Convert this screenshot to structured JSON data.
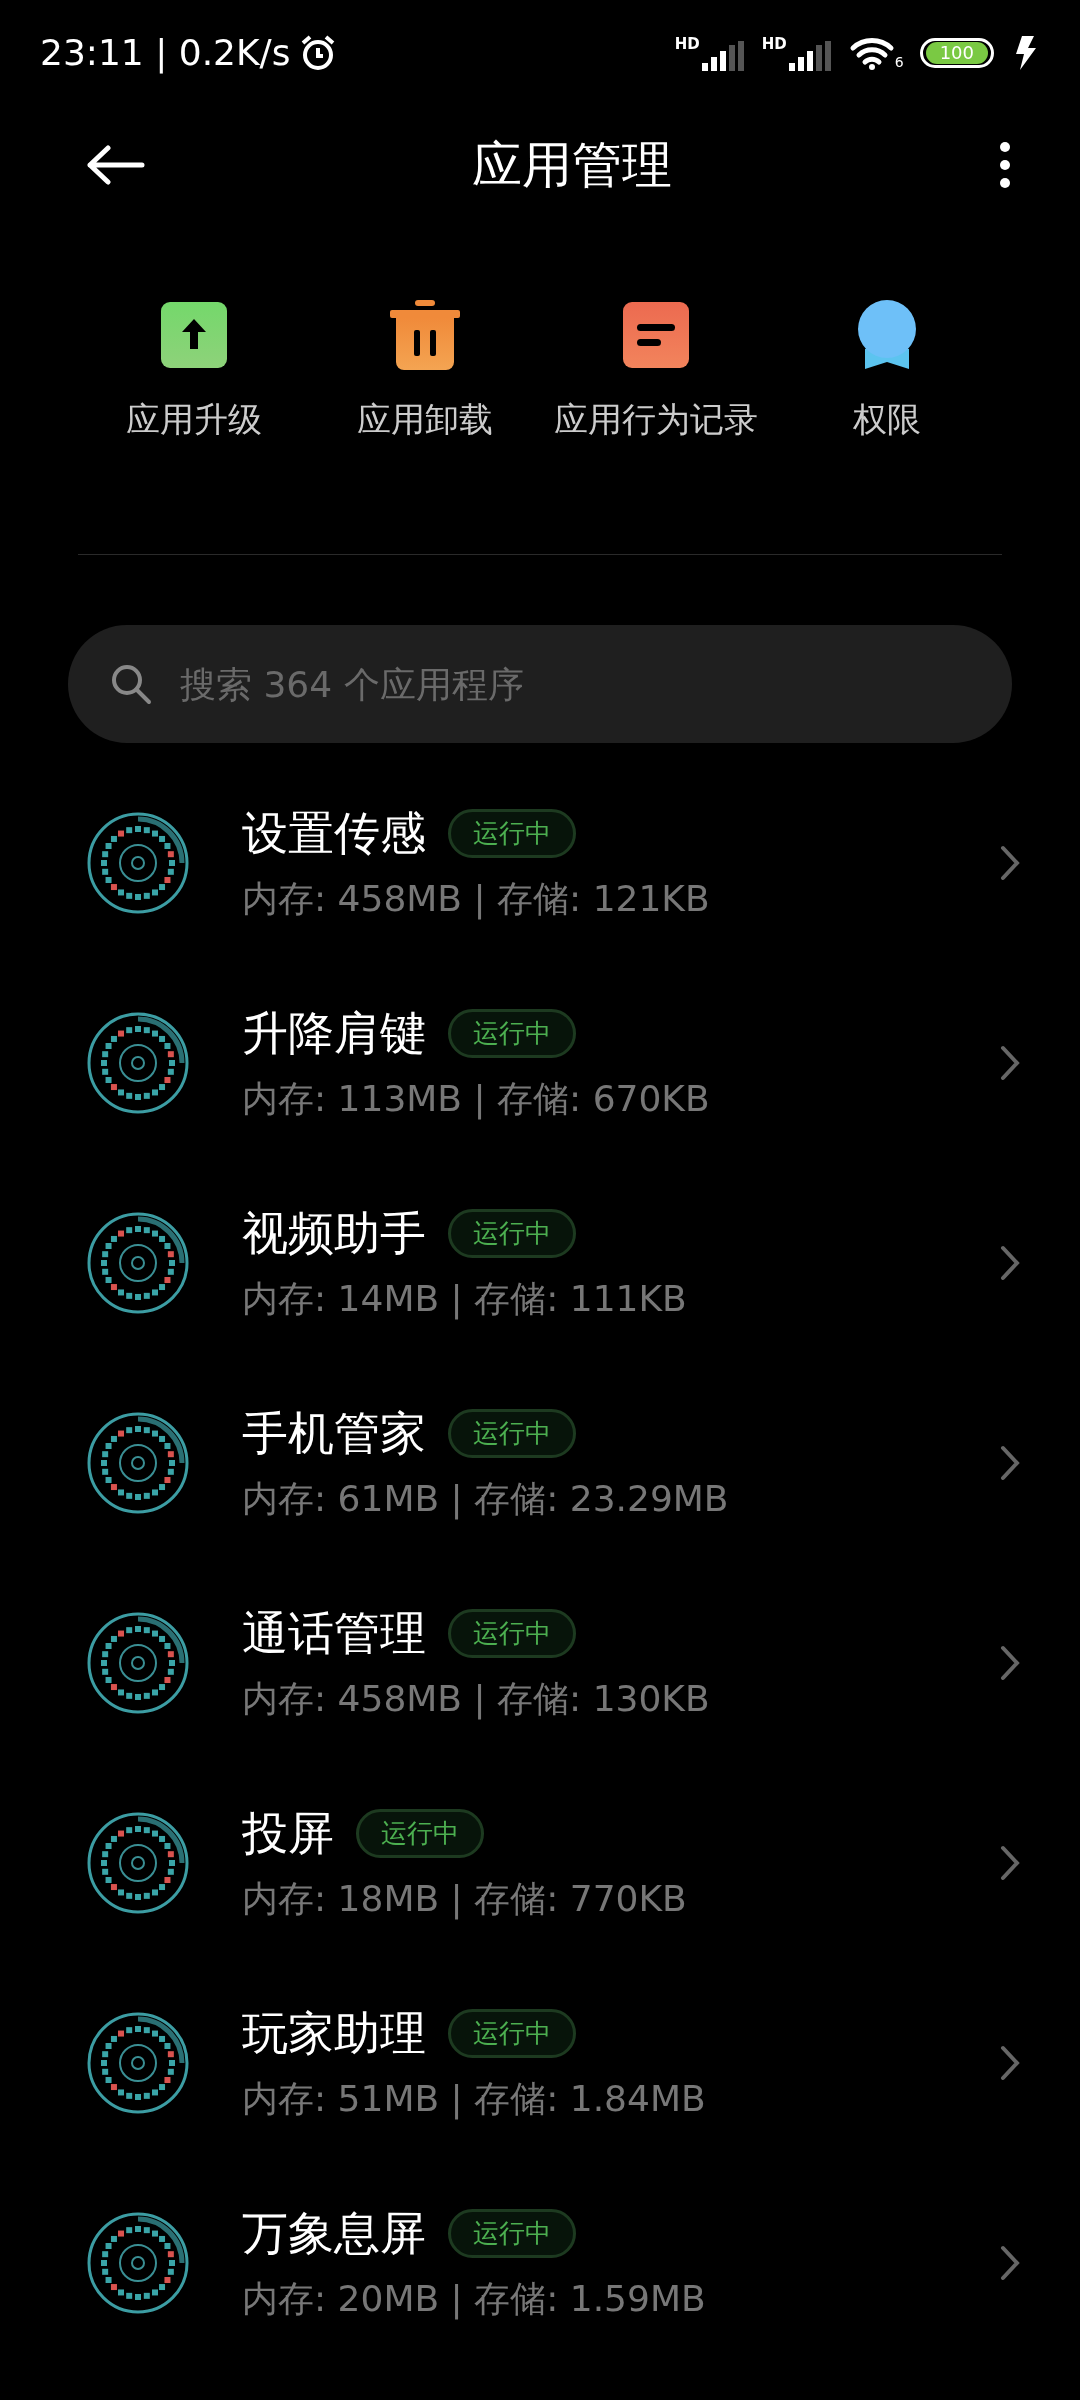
{
  "status_bar": {
    "time_speed": "23:11 | 0.2K/s",
    "signals": [
      {
        "label": "HD"
      },
      {
        "label": "HD"
      }
    ],
    "wifi_badge": "6",
    "battery": "100"
  },
  "header": {
    "title": "应用管理"
  },
  "quick_actions": [
    {
      "kind": "upgrade",
      "label": "应用升级"
    },
    {
      "kind": "uninstall",
      "label": "应用卸载"
    },
    {
      "kind": "record",
      "label": "应用行为记录"
    },
    {
      "kind": "permission",
      "label": "权限"
    }
  ],
  "search": {
    "placeholder": "搜索 364 个应用程序"
  },
  "apps": [
    {
      "name": "设置传感",
      "badge": "运行中",
      "memory": "内存: 458MB | 存储: 121KB"
    },
    {
      "name": "升降肩键",
      "badge": "运行中",
      "memory": "内存: 113MB | 存储: 670KB"
    },
    {
      "name": "视频助手",
      "badge": "运行中",
      "memory": "内存: 14MB | 存储: 111KB"
    },
    {
      "name": "手机管家",
      "badge": "运行中",
      "memory": "内存: 61MB | 存储: 23.29MB"
    },
    {
      "name": "通话管理",
      "badge": "运行中",
      "memory": "内存: 458MB | 存储: 130KB"
    },
    {
      "name": "投屏",
      "badge": "运行中",
      "memory": "内存: 18MB | 存储: 770KB"
    },
    {
      "name": "玩家助理",
      "badge": "运行中",
      "memory": "内存: 51MB | 存储: 1.84MB"
    },
    {
      "name": "万象息屏",
      "badge": "运行中",
      "memory": "内存: 20MB | 存储: 1.59MB"
    }
  ]
}
